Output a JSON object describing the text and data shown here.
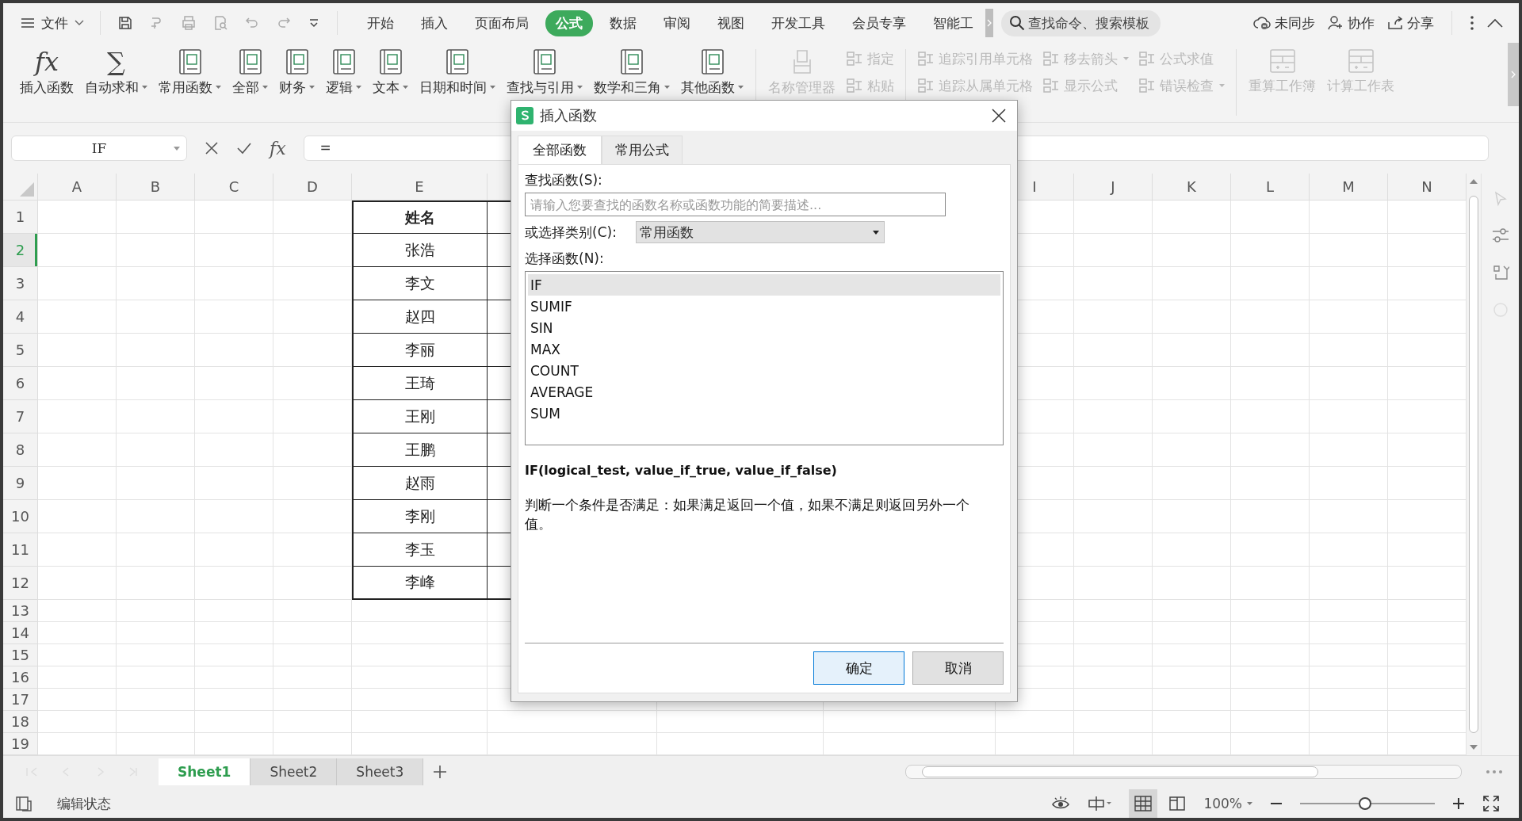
{
  "title_bar": {
    "menu": "文件",
    "tabs": [
      {
        "label": "开始",
        "selected": false
      },
      {
        "label": "插入",
        "selected": false
      },
      {
        "label": "页面布局",
        "selected": false
      },
      {
        "label": "公式",
        "selected": true
      },
      {
        "label": "数据",
        "selected": false
      },
      {
        "label": "审阅",
        "selected": false
      },
      {
        "label": "视图",
        "selected": false
      },
      {
        "label": "开发工具",
        "selected": false
      },
      {
        "label": "会员专享",
        "selected": false
      },
      {
        "label": "智能工",
        "selected": false
      }
    ],
    "search": {
      "placeholder": "查找命令、搜索模板"
    },
    "actions": [
      "未同步",
      "协作",
      "分享"
    ]
  },
  "ribbon": {
    "columns": [
      {
        "kind": "glyph",
        "glyph": "fx",
        "label": "插入函数",
        "dropdown": false,
        "disabled": false
      },
      {
        "kind": "glyph",
        "glyph": "∑",
        "label": "自动求和",
        "dropdown": true,
        "disabled": false
      },
      {
        "kind": "book",
        "label": "常用函数",
        "dropdown": true,
        "disabled": false
      },
      {
        "kind": "book",
        "label": "全部",
        "dropdown": true,
        "disabled": false
      },
      {
        "kind": "book",
        "label": "财务",
        "dropdown": true,
        "disabled": false
      },
      {
        "kind": "book",
        "label": "逻辑",
        "dropdown": true,
        "disabled": false
      },
      {
        "kind": "book",
        "label": "文本",
        "dropdown": true,
        "disabled": false
      },
      {
        "kind": "book",
        "label": "日期和时间",
        "dropdown": true,
        "disabled": false
      },
      {
        "kind": "book",
        "label": "查找与引用",
        "dropdown": true,
        "disabled": false
      },
      {
        "kind": "book",
        "label": "数学和三角",
        "dropdown": true,
        "disabled": false
      },
      {
        "kind": "book",
        "label": "其他函数",
        "dropdown": true,
        "disabled": false
      },
      {
        "kind": "separator"
      },
      {
        "kind": "tray",
        "label": "名称管理器",
        "dropdown": false,
        "disabled": true
      },
      {
        "kind": "stack",
        "items": [
          {
            "label": "指定",
            "dropdown": false,
            "disabled": true
          },
          {
            "label": "粘贴",
            "dropdown": false,
            "disabled": true
          }
        ]
      },
      {
        "kind": "separator"
      },
      {
        "kind": "stack",
        "items": [
          {
            "label": "追踪引用单元格",
            "dropdown": false,
            "disabled": true
          },
          {
            "label": "追踪从属单元格",
            "dropdown": false,
            "disabled": true
          }
        ]
      },
      {
        "kind": "stack",
        "items": [
          {
            "label": "移去箭头",
            "dropdown": true,
            "disabled": true
          },
          {
            "label": "显示公式",
            "dropdown": false,
            "disabled": true
          }
        ]
      },
      {
        "kind": "stack",
        "items": [
          {
            "label": "公式求值",
            "dropdown": false,
            "disabled": true
          },
          {
            "label": "错误检查",
            "dropdown": true,
            "disabled": true
          }
        ]
      },
      {
        "kind": "separator"
      },
      {
        "kind": "calc",
        "label": "重算工作簿",
        "dropdown": false,
        "disabled": true
      },
      {
        "kind": "calc",
        "label": "计算工作表",
        "dropdown": false,
        "disabled": true
      }
    ]
  },
  "formula_bar": {
    "name_box": "IF",
    "fx": "fx",
    "value": "="
  },
  "sheet": {
    "columns": [
      {
        "letter": "A"
      },
      {
        "letter": "B"
      },
      {
        "letter": "C"
      },
      {
        "letter": "D"
      },
      {
        "letter": "E"
      },
      {},
      {},
      {},
      {
        "letter": "I"
      },
      {
        "letter": "J"
      },
      {
        "letter": "K"
      },
      {
        "letter": "L"
      },
      {
        "letter": "M"
      },
      {
        "letter": "N"
      }
    ],
    "rows": [
      {
        "number": "1",
        "selected": false,
        "name": "姓名",
        "header": true
      },
      {
        "number": "2",
        "selected": true,
        "name": "张浩",
        "header": false
      },
      {
        "number": "3",
        "selected": false,
        "name": "李文",
        "header": false
      },
      {
        "number": "4",
        "selected": false,
        "name": "赵四",
        "header": false
      },
      {
        "number": "5",
        "selected": false,
        "name": "李丽",
        "header": false
      },
      {
        "number": "6",
        "selected": false,
        "name": "王琦",
        "header": false
      },
      {
        "number": "7",
        "selected": false,
        "name": "王刚",
        "header": false
      },
      {
        "number": "8",
        "selected": false,
        "name": "王鹏",
        "header": false
      },
      {
        "number": "9",
        "selected": false,
        "name": "赵雨",
        "header": false
      },
      {
        "number": "10",
        "selected": false,
        "name": "李刚",
        "header": false
      },
      {
        "number": "11",
        "selected": false,
        "name": "李玉",
        "header": false
      },
      {
        "number": "12",
        "selected": false,
        "name": "李峰",
        "header": false
      },
      {
        "number": "13",
        "selected": false
      },
      {
        "number": "14",
        "selected": false
      },
      {
        "number": "15",
        "selected": false
      },
      {
        "number": "16",
        "selected": false
      },
      {
        "number": "17",
        "selected": false
      },
      {
        "number": "18",
        "selected": false
      },
      {
        "number": "19",
        "selected": false
      }
    ]
  },
  "sheet_tabs": [
    {
      "label": "Sheet1",
      "selected": true
    },
    {
      "label": "Sheet2",
      "selected": false
    },
    {
      "label": "Sheet3",
      "selected": false
    }
  ],
  "status_bar": {
    "mode": "编辑状态",
    "zoom": "100%",
    "level": 0.48
  },
  "dialog": {
    "title": "插入函数",
    "tabs": [
      {
        "label": "全部函数",
        "selected": true
      },
      {
        "label": "常用公式",
        "selected": false
      }
    ],
    "search_label": "查找函数(S):",
    "search_placeholder": "请输入您要查找的函数名称或函数功能的简要描述...",
    "category_label": "或选择类别(C):",
    "category": "常用函数",
    "list_label": "选择函数(N):",
    "functions": [
      {
        "name": "IF",
        "selected": true
      },
      {
        "name": "SUMIF",
        "selected": false
      },
      {
        "name": "SIN",
        "selected": false
      },
      {
        "name": "MAX",
        "selected": false
      },
      {
        "name": "COUNT",
        "selected": false
      },
      {
        "name": "AVERAGE",
        "selected": false
      },
      {
        "name": "SUM",
        "selected": false
      }
    ],
    "signature": "IF(logical_test, value_if_true, value_if_false)",
    "description": "判断一个条件是否满足：如果满足返回一个值，如果不满足则返回另外一个值。",
    "buttons": [
      {
        "label": "确定",
        "primary": true
      },
      {
        "label": "取消",
        "primary": false
      }
    ]
  }
}
